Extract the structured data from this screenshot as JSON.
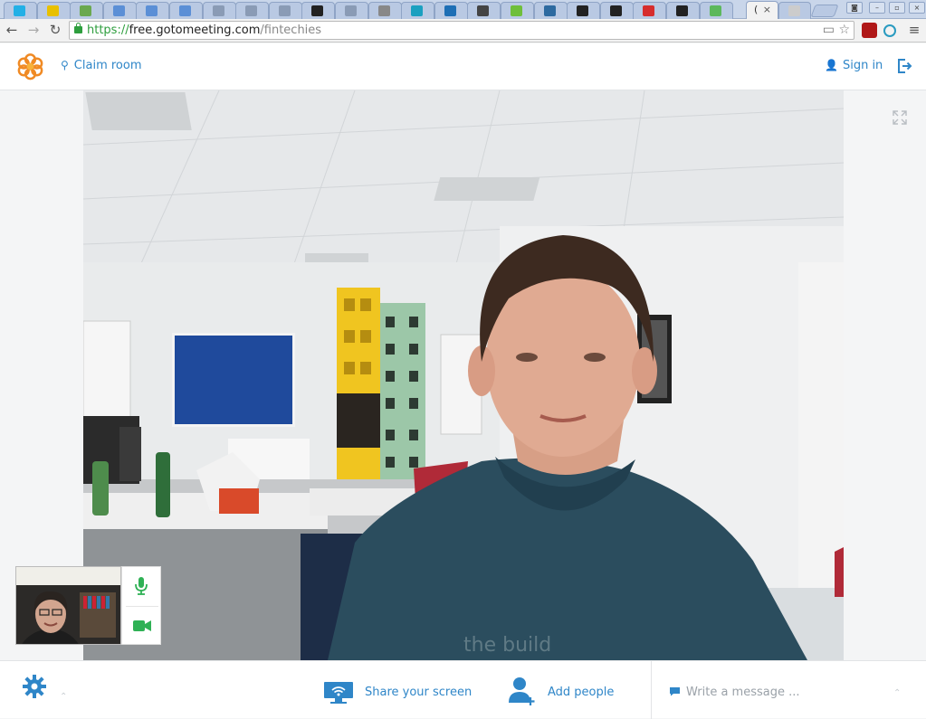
{
  "browser": {
    "active_tab_label": "(",
    "active_tab_close": "×",
    "tab_favicon_colors": [
      "#23b0e6",
      "#e8c000",
      "#6aa84f",
      "#5b8fd6",
      "#5b8fd6",
      "#5b8fd6",
      "#8a9bb5",
      "#8a9bb5",
      "#8a9bb5",
      "#222222",
      "#8a9bb5",
      "#888888",
      "#1aa0c0",
      "#1e6fb5",
      "#444444",
      "#6fbf3a",
      "#2d6aa0",
      "#222222",
      "#222222",
      "#d62d2d",
      "#222222",
      "#5cb85c"
    ],
    "url_scheme": "https://",
    "url_host": "free.gotomeeting.com",
    "url_path": "/fintechies",
    "back_icon": "←",
    "forward_icon": "→",
    "reload_icon": "↻",
    "menu_icon": "≡",
    "star_icon": "☆",
    "camera_icon": "▭"
  },
  "header": {
    "claim_icon": "⚲",
    "claim_label": "Claim room",
    "signin_icon": "👤",
    "signin_label": "Sign in"
  },
  "bottom": {
    "share_label": "Share your screen",
    "add_people_label": "Add people",
    "message_placeholder": "Write a message ...",
    "caret_icon": "⌃"
  },
  "colors": {
    "accent": "#2f86c8",
    "media_green": "#2fb155",
    "logo_orange": "#f08a24"
  }
}
